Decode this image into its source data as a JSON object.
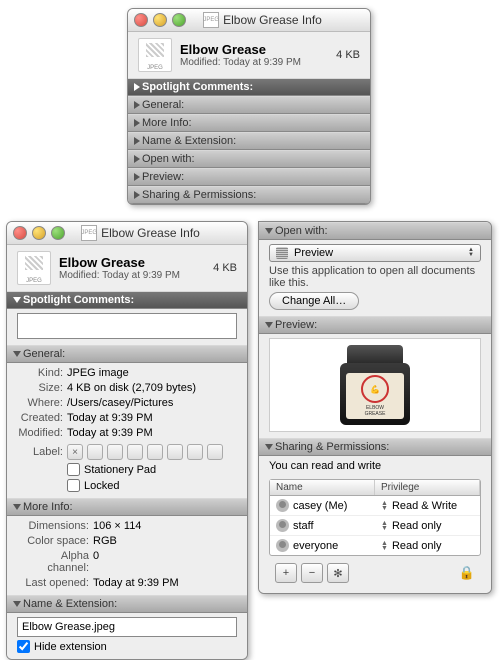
{
  "top_window": {
    "title": "Elbow Grease Info",
    "proxy_label": "JPEG",
    "file_name": "Elbow Grease",
    "file_size": "4 KB",
    "modified_line": "Modified: Today at 9:39 PM",
    "sections": {
      "spotlight": "Spotlight Comments:",
      "general": "General:",
      "moreinfo": "More Info:",
      "nameext": "Name & Extension:",
      "openwith": "Open with:",
      "preview": "Preview:",
      "sharing": "Sharing & Permissions:"
    }
  },
  "left_window": {
    "title": "Elbow Grease Info",
    "proxy_label": "JPEG",
    "file_name": "Elbow Grease",
    "file_size": "4 KB",
    "modified_line": "Modified: Today at 9:39 PM",
    "section_titles": {
      "spotlight": "Spotlight Comments:",
      "general": "General:",
      "moreinfo": "More Info:",
      "nameext": "Name & Extension:"
    },
    "spotlight_comment": "",
    "general": {
      "kind_label": "Kind:",
      "kind_value": "JPEG image",
      "size_label": "Size:",
      "size_value": "4 KB on disk (2,709 bytes)",
      "where_label": "Where:",
      "where_value": "/Users/casey/Pictures",
      "created_label": "Created:",
      "created_value": "Today at 9:39 PM",
      "modified_label": "Modified:",
      "modified_value": "Today at 9:39 PM",
      "label_label": "Label:",
      "stationery_label": "Stationery Pad",
      "locked_label": "Locked"
    },
    "moreinfo": {
      "dimensions_label": "Dimensions:",
      "dimensions_value": "106 × 114",
      "colorspace_label": "Color space:",
      "colorspace_value": "RGB",
      "alpha_label": "Alpha channel:",
      "alpha_value": "0",
      "lastopened_label": "Last opened:",
      "lastopened_value": "Today at 9:39 PM"
    },
    "nameext": {
      "filename_value": "Elbow Grease.jpeg",
      "hide_label": "Hide extension",
      "hide_checked": true
    }
  },
  "right_panel": {
    "openwith": {
      "title": "Open with:",
      "selected_app": "Preview",
      "help_text": "Use this application to open all documents like this.",
      "change_all_label": "Change All…"
    },
    "preview": {
      "title": "Preview:",
      "jar_label_top": "ELBOW",
      "jar_label_bottom": "GREASE"
    },
    "sharing": {
      "title": "Sharing & Permissions:",
      "summary": "You can read and write",
      "col_name": "Name",
      "col_priv": "Privilege",
      "rows": [
        {
          "name": "casey (Me)",
          "priv": "Read & Write"
        },
        {
          "name": "staff",
          "priv": "Read only"
        },
        {
          "name": "everyone",
          "priv": "Read only"
        }
      ],
      "add_label": "+",
      "remove_label": "−"
    }
  }
}
